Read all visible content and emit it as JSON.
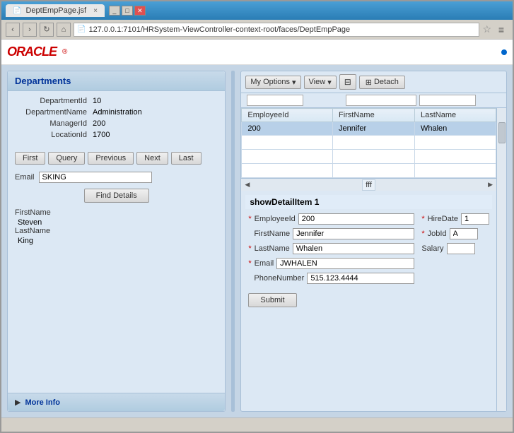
{
  "browser": {
    "title": "DeptEmpPage.jsf",
    "address": "127.0.0.1:7101/HRSystem-ViewController-context-root/faces/DeptEmpPage",
    "tab_close": "×"
  },
  "window_controls": {
    "minimize": "_",
    "maximize": "□",
    "close": "✕"
  },
  "nav": {
    "back": "‹",
    "forward": "›",
    "refresh": "↻",
    "home": "⌂",
    "star": "☆",
    "menu": "≡"
  },
  "oracle_logo": "ORACLE",
  "departments": {
    "title": "Departments",
    "fields": {
      "department_id_label": "DepartmentId",
      "department_id_value": "10",
      "department_name_label": "DepartmentName",
      "department_name_value": "Administration",
      "manager_id_label": "ManagerId",
      "manager_id_value": "200",
      "location_id_label": "LocationId",
      "location_id_value": "1700"
    },
    "nav_buttons": {
      "first": "First",
      "query": "Query",
      "previous": "Previous",
      "next": "Next",
      "last": "Last"
    },
    "email_label": "Email",
    "email_value": "SKING",
    "find_details": "Find Details",
    "result": {
      "firstname_label": "FirstName",
      "firstname_value": "Steven",
      "lastname_label": "LastName",
      "lastname_value": "King"
    },
    "more_info": "More Info"
  },
  "table_toolbar": {
    "my_options": "My Options",
    "view": "View",
    "detach": "Detach",
    "dropdown_arrow": "▾",
    "edit_icon": "✎",
    "detach_icon": "⊞"
  },
  "table": {
    "columns": [
      "EmployeeId",
      "FirstName",
      "LastName"
    ],
    "rows": [
      {
        "employee_id": "200",
        "first_name": "Jennifer",
        "last_name": "Whalen"
      }
    ]
  },
  "detail": {
    "title": "showDetailItem 1",
    "employee_id_label": "EmployeeId",
    "employee_id_value": "200",
    "hire_date_label": "HireDate",
    "hire_date_value": "1",
    "firstname_label": "FirstName",
    "firstname_value": "Jennifer",
    "job_id_label": "JobId",
    "job_id_value": "A",
    "lastname_label": "LastName",
    "lastname_value": "Whalen",
    "salary_label": "Salary",
    "salary_value": "",
    "email_label": "Email",
    "email_value": "JWHALEN",
    "phone_label": "PhoneNumber",
    "phone_value": "515.123.4444",
    "submit": "Submit"
  }
}
